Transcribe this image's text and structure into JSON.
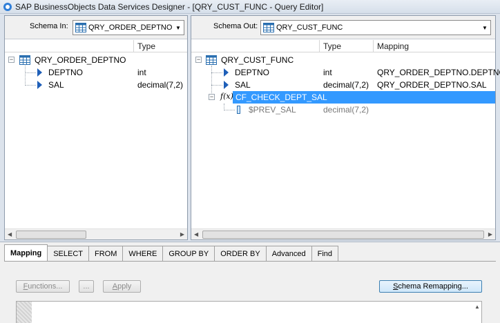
{
  "window": {
    "title": "SAP BusinessObjects Data Services Designer - [QRY_CUST_FUNC - Query Editor]"
  },
  "schema_in": {
    "label": "Schema In:",
    "combo_value": "QRY_ORDER_DEPTNO",
    "columns": {
      "type": "Type"
    },
    "root": "QRY_ORDER_DEPTNO",
    "rows": [
      {
        "name": "DEPTNO",
        "type": "int"
      },
      {
        "name": "SAL",
        "type": "decimal(7,2)"
      }
    ]
  },
  "schema_out": {
    "label": "Schema Out:",
    "combo_value": "QRY_CUST_FUNC",
    "columns": {
      "type": "Type",
      "mapping": "Mapping"
    },
    "root": "QRY_CUST_FUNC",
    "rows": [
      {
        "name": "DEPTNO",
        "type": "int",
        "mapping": "QRY_ORDER_DEPTNO.DEPTNO"
      },
      {
        "name": "SAL",
        "type": "decimal(7,2)",
        "mapping": "QRY_ORDER_DEPTNO.SAL"
      }
    ],
    "function": {
      "icon_text": "f(x)",
      "name": "CF_CHECK_DEPT_SAL"
    },
    "variable": {
      "name": "$PREV_SAL",
      "type": "decimal(7,2)"
    }
  },
  "tabs": [
    "Mapping",
    "SELECT",
    "FROM",
    "WHERE",
    "GROUP BY",
    "ORDER BY",
    "Advanced",
    "Find"
  ],
  "buttons": {
    "functions_u": "F",
    "functions_rest": "unctions...",
    "ellipsis": "...",
    "apply_u": "A",
    "apply_rest": "pply",
    "remap_u": "S",
    "remap_rest": "chema Remapping..."
  },
  "colors": {
    "selection": "#3399ff",
    "accent": "#1f5fb8"
  },
  "icons": [
    "app-icon",
    "table-icon",
    "expand-collapse-icon",
    "column-arrow-icon",
    "function-icon",
    "variable-icon",
    "dropdown-arrow-icon",
    "scroll-left-icon",
    "scroll-right-icon",
    "scroll-up-icon"
  ]
}
